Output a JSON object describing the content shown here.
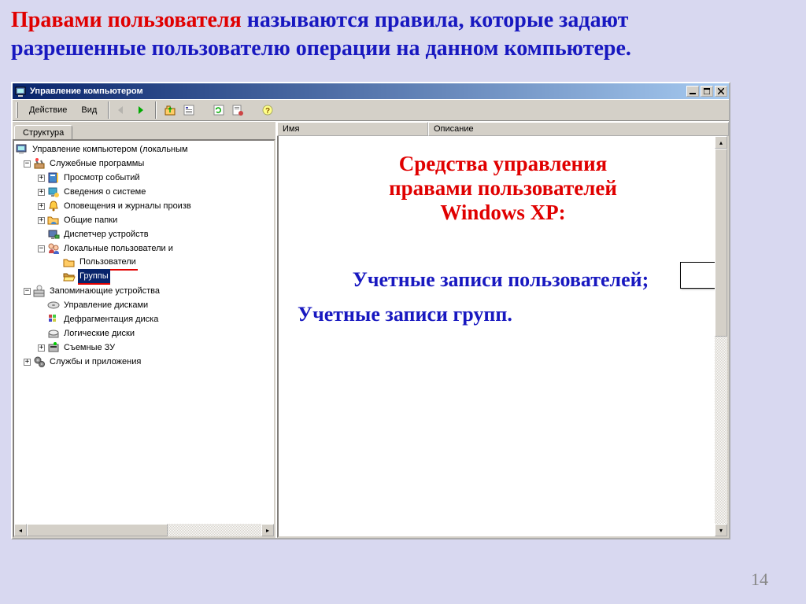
{
  "header": {
    "highlight": "Правами пользователя",
    "rest1": " называются правила, которые задают",
    "line2": "разрешенные пользователю операции на данном компьютере."
  },
  "window": {
    "title": "Управление компьютером"
  },
  "toolbar": {
    "menu_action": "Действие",
    "menu_view": "Вид"
  },
  "left_tab": "Структура",
  "columns": {
    "name": "Имя",
    "description": "Описание"
  },
  "tree": {
    "root": "Управление компьютером (локальным",
    "system_tools": "Служебные программы",
    "event_viewer": "Просмотр событий",
    "system_info": "Сведения о системе",
    "alerts": "Оповещения и журналы произв",
    "shared_folders": "Общие папки",
    "device_manager": "Диспетчер устройств",
    "local_users": "Локальные пользователи и",
    "users": "Пользователи",
    "groups": "Группы",
    "storage": "Запоминающие устройства",
    "disk_mgmt": "Управление дисками",
    "defrag": "Дефрагментация диска",
    "logical_disks": "Логические диски",
    "removable": "Съемные ЗУ",
    "services": "Службы и приложения"
  },
  "overlay": {
    "title1": "Средства управления",
    "title2": "правами пользователей",
    "title3": "Windows XP:",
    "item1": "Учетные записи пользователей;",
    "item2": "Учетные записи групп."
  },
  "page_number": "14"
}
